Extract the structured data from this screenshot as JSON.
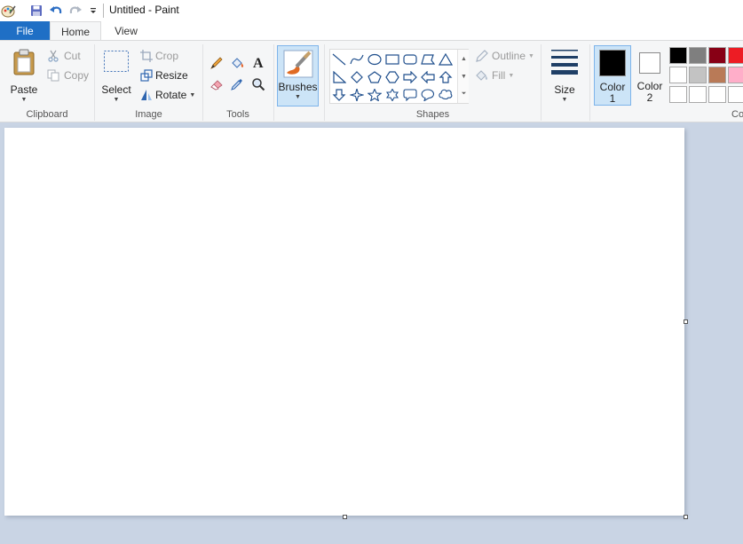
{
  "window": {
    "title": "Untitled - Paint"
  },
  "quick_access": {
    "icons": [
      "paint-app-icon",
      "save-icon",
      "undo-icon",
      "redo-icon",
      "customize-dropdown-icon"
    ]
  },
  "tabs": [
    {
      "label": "File"
    },
    {
      "label": "Home"
    },
    {
      "label": "View"
    }
  ],
  "ribbon": {
    "clipboard": {
      "group_label": "Clipboard",
      "paste": "Paste",
      "cut": "Cut",
      "copy": "Copy"
    },
    "image": {
      "group_label": "Image",
      "select": "Select",
      "crop": "Crop",
      "resize": "Resize",
      "rotate": "Rotate"
    },
    "tools": {
      "group_label": "Tools",
      "icons": [
        "pencil-icon",
        "fill-bucket-icon",
        "text-icon",
        "eraser-icon",
        "color-picker-icon",
        "magnifier-icon"
      ]
    },
    "brushes": {
      "label": "Brushes"
    },
    "shapes": {
      "group_label": "Shapes",
      "outline": "Outline",
      "fill": "Fill",
      "items": [
        "line",
        "curve",
        "oval",
        "rectangle",
        "rounded-rectangle",
        "polygon",
        "triangle",
        "right-triangle",
        "diamond",
        "pentagon",
        "hexagon",
        "right-arrow",
        "left-arrow",
        "up-arrow",
        "down-arrow",
        "four-point-star",
        "five-point-star",
        "six-point-star",
        "rounded-callout",
        "oval-callout",
        "cloud-callout"
      ]
    },
    "size": {
      "label": "Size"
    },
    "color1": {
      "label_line1": "Color",
      "label_line2": "1",
      "value": "#000000"
    },
    "color2": {
      "label_line1": "Color",
      "label_line2": "2",
      "value": "#ffffff"
    },
    "colors": {
      "group_label_visible": "Co",
      "palette_row1": [
        "#000000",
        "#7f7f7f",
        "#880015",
        "#ed1c24"
      ],
      "palette_row2": [
        "#ffffff",
        "#c3c3c3",
        "#b97a57",
        "#ffaec9"
      ],
      "palette_row3": [
        "#ffffff",
        "#ffffff",
        "#ffffff",
        "#ffffff"
      ]
    }
  },
  "accent": {
    "file_tab": "#1f6fc5",
    "selection": "#cce4f7",
    "workspace": "#c9d4e4"
  }
}
